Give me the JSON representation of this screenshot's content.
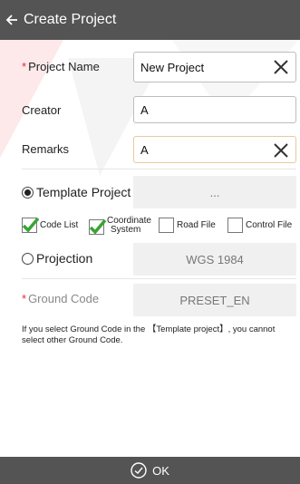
{
  "header": {
    "title": "Create Project",
    "back_icon": "arrow-left-icon"
  },
  "form": {
    "project_name": {
      "label": "Project Name",
      "value": "New Project",
      "required": true
    },
    "creator": {
      "label": "Creator",
      "value": "A"
    },
    "remarks": {
      "label": "Remarks",
      "value": "A"
    },
    "template_project": {
      "label": "Template Project",
      "value": "...",
      "selected": true
    },
    "files": [
      {
        "label": "Code List",
        "checked": true
      },
      {
        "label_line1": "Coordinate",
        "label_line2": "System",
        "checked": true
      },
      {
        "label": "Road File",
        "checked": false
      },
      {
        "label": "Control File",
        "checked": false
      }
    ],
    "projection": {
      "label": "Projection",
      "value": "WGS 1984",
      "selected": false
    },
    "ground_code": {
      "label": "Ground Code",
      "value": "PRESET_EN",
      "required": true
    },
    "hint": "If you select Ground Code in the 【Template project】, you cannot select other Ground Code."
  },
  "footer": {
    "ok_label": "OK",
    "ok_icon": "check-circle-icon"
  },
  "colors": {
    "bar": "#545454",
    "required": "#e0303a",
    "check": "#3aa335"
  }
}
